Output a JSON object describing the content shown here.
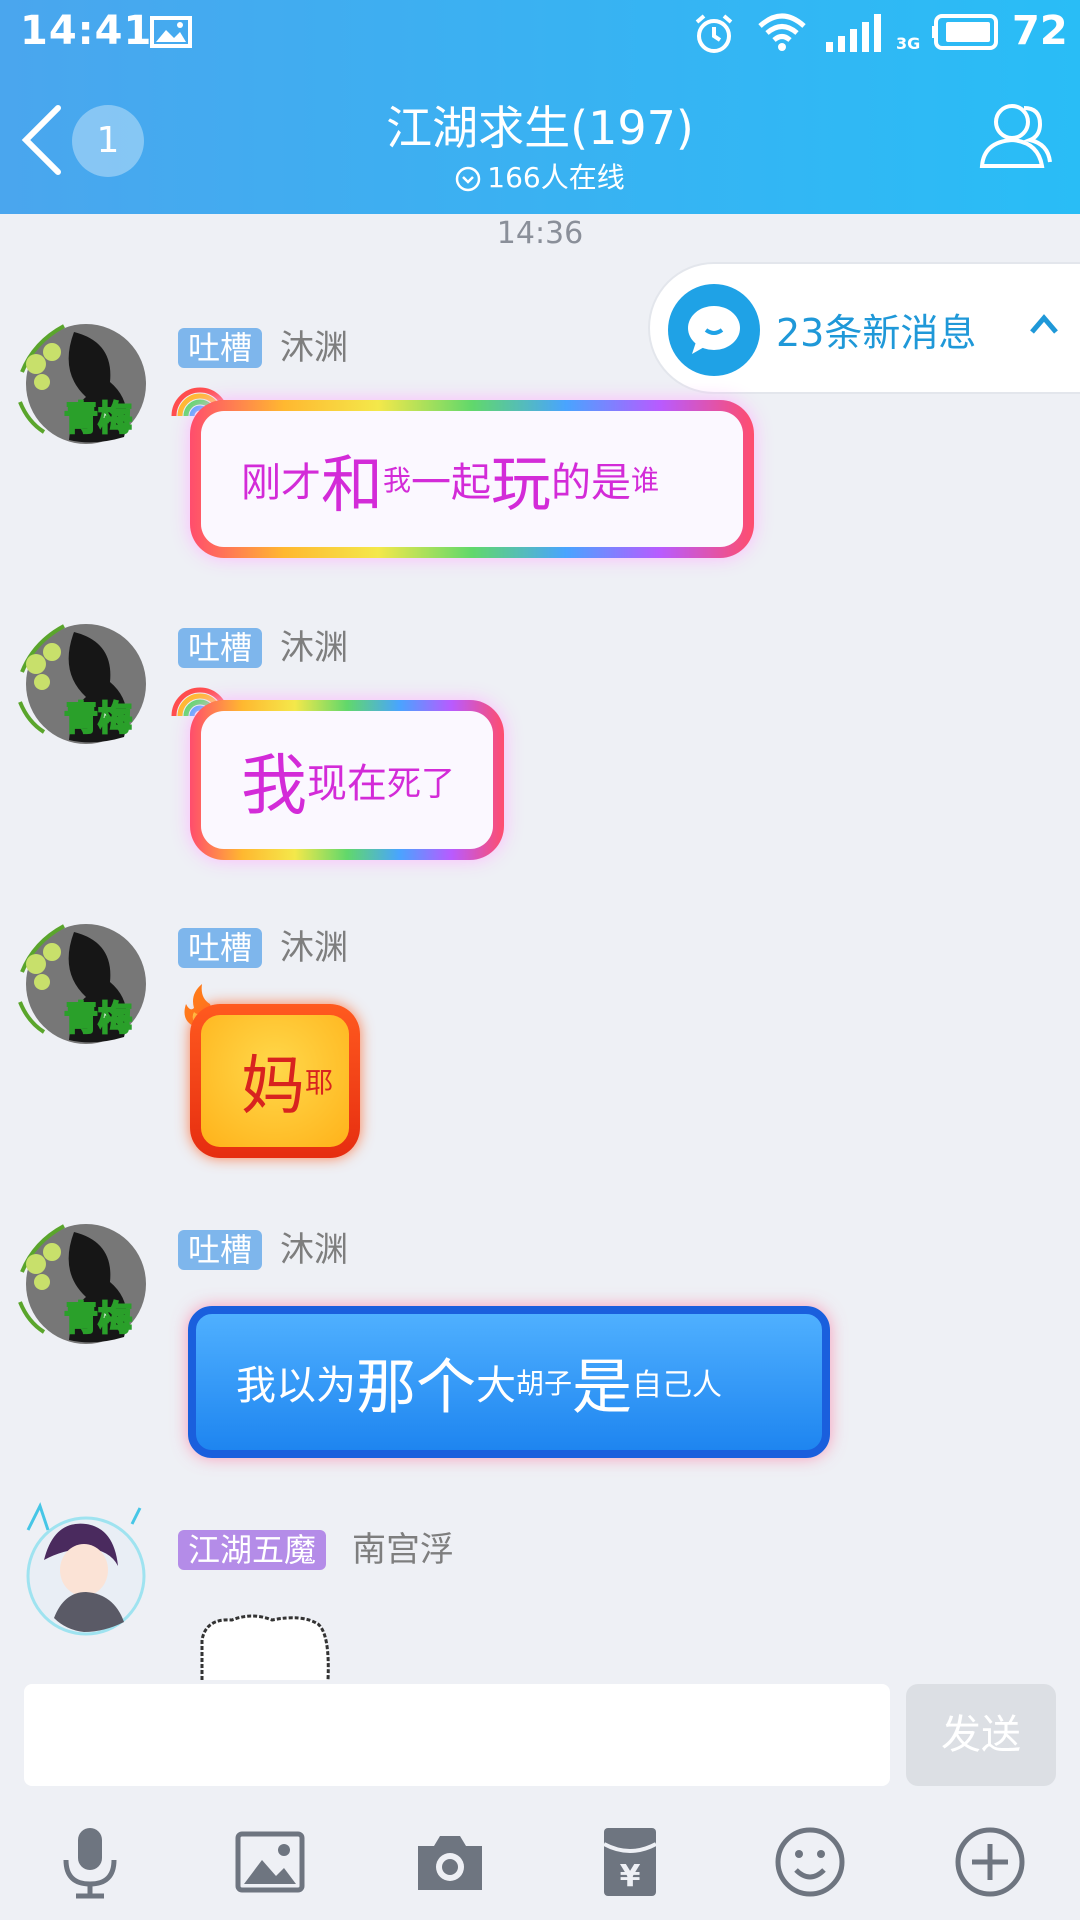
{
  "status_bar": {
    "time": "14:41",
    "network": "3G",
    "battery": "72"
  },
  "header": {
    "back_count": "1",
    "title": "江湖求生(197)",
    "online": "166人在线"
  },
  "timestamp": "14:36",
  "new_messages": {
    "text": "23条新消息"
  },
  "messages": [
    {
      "tag": "吐槽",
      "nick": "沐渊",
      "avatar_label": "青梅",
      "segments": [
        "刚才",
        "和",
        "我",
        "一起",
        "玩",
        "的是",
        "谁"
      ]
    },
    {
      "tag": "吐槽",
      "nick": "沐渊",
      "avatar_label": "青梅",
      "segments": [
        "我",
        "现在",
        "死了"
      ]
    },
    {
      "tag": "吐槽",
      "nick": "沐渊",
      "avatar_label": "青梅",
      "segments": [
        "妈",
        "耶"
      ]
    },
    {
      "tag": "吐槽",
      "nick": "沐渊",
      "avatar_label": "青梅",
      "segments": [
        "我以为",
        "那个",
        "大",
        "胡子",
        "是",
        "自己人"
      ]
    },
    {
      "tag": "江湖五魔",
      "nick": "南宫浮"
    }
  ],
  "input": {
    "placeholder": "",
    "send_label": "发送"
  },
  "toolbar": [
    "microphone-icon",
    "image-icon",
    "camera-icon",
    "red-packet-icon",
    "emoji-icon",
    "plus-icon"
  ],
  "colors": {
    "header_start": "#4aa6ee",
    "header_end": "#29bdf6",
    "tag_blue": "#7eb6ec",
    "tag_purple": "#b48ce8",
    "accent": "#1f98d8"
  }
}
